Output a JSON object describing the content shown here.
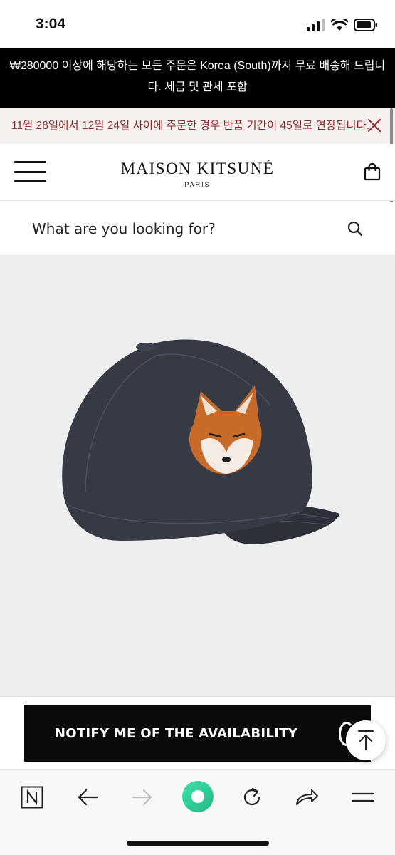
{
  "status_bar": {
    "time": "3:04",
    "icons": [
      "signal-icon",
      "wifi-icon",
      "battery-icon"
    ]
  },
  "promo_banner": {
    "line1": "₩280000 이상에 해당하는 모든 주문은 Korea (South)까지 무료 배송해 드립니",
    "line2": "다. 세금 및 관세 포함"
  },
  "notice": {
    "text": "11월 28일에서 12월 24일 사이에 주문한 경우 반품 기간이 45일로 연장됩니다.",
    "color": "#8b2c2c"
  },
  "header": {
    "brand_name": "MAISON KITSUNÉ",
    "brand_sub": "PARIS",
    "menu_icon": "hamburger-icon",
    "bag_icon": "shopping-bag-icon"
  },
  "search": {
    "placeholder": "What are you looking for?",
    "icon": "search-icon"
  },
  "gallery": {
    "slide_count": 3,
    "active_slide": 1
  },
  "cta": {
    "notify_label": "NOTIFY ME OF THE AVAILABILITY",
    "scroll_top_icon": "arrow-up-to-top-icon"
  },
  "browser_toolbar": {
    "items": [
      "n-logo-icon",
      "back-arrow-icon",
      "forward-arrow-icon",
      "green-orb-icon",
      "reload-icon",
      "share-icon",
      "menu-icon"
    ],
    "accent": "#2fd39a"
  }
}
